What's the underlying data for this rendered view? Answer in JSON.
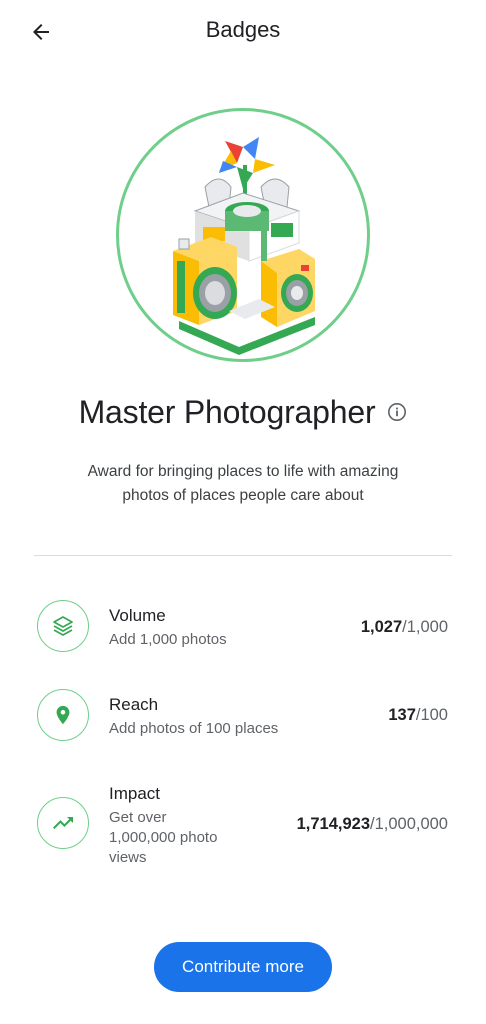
{
  "app_bar": {
    "title": "Badges",
    "back_icon": "arrow-back-icon"
  },
  "badge": {
    "title": "Master Photographer",
    "info_icon": "info-icon",
    "description": "Award for bringing places to life with amazing photos of places people care about",
    "ring_color": "#6fcf8a"
  },
  "criteria": [
    {
      "name": "Volume",
      "description": "Add 1,000 photos",
      "current": "1,027",
      "target": "/1,000",
      "icon": "layers-icon"
    },
    {
      "name": "Reach",
      "description": "Add photos of 100 places",
      "current": "137",
      "target": "/100",
      "icon": "location-pin-icon"
    },
    {
      "name": "Impact",
      "description_lines": [
        "Get over",
        "1,000,000 photo",
        "views"
      ],
      "current": "1,714,923",
      "target": "/1,000,000",
      "icon": "trending-up-icon"
    }
  ],
  "cta": {
    "label": "Contribute more",
    "color": "#1a73e8"
  }
}
